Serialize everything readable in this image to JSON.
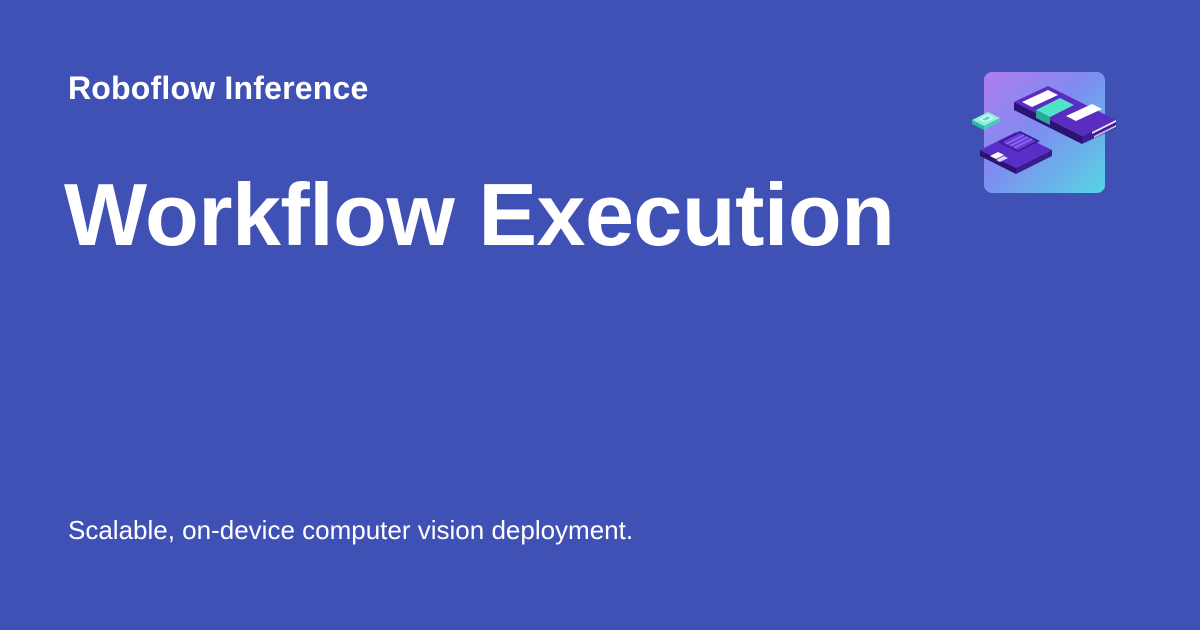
{
  "header": {
    "site_name": "Roboflow Inference"
  },
  "main": {
    "title": "Workflow Execution"
  },
  "footer": {
    "tagline": "Scalable, on-device computer vision deployment."
  },
  "logo": {
    "icon": "isometric-hardware-icon"
  },
  "colors": {
    "background": "#3f51b5",
    "text": "#ffffff",
    "tile_gradient_start": "#b07cf0",
    "tile_gradient_end": "#56d6e3",
    "chip_purple": "#4b1f9e",
    "chip_teal": "#4fe3c8"
  }
}
